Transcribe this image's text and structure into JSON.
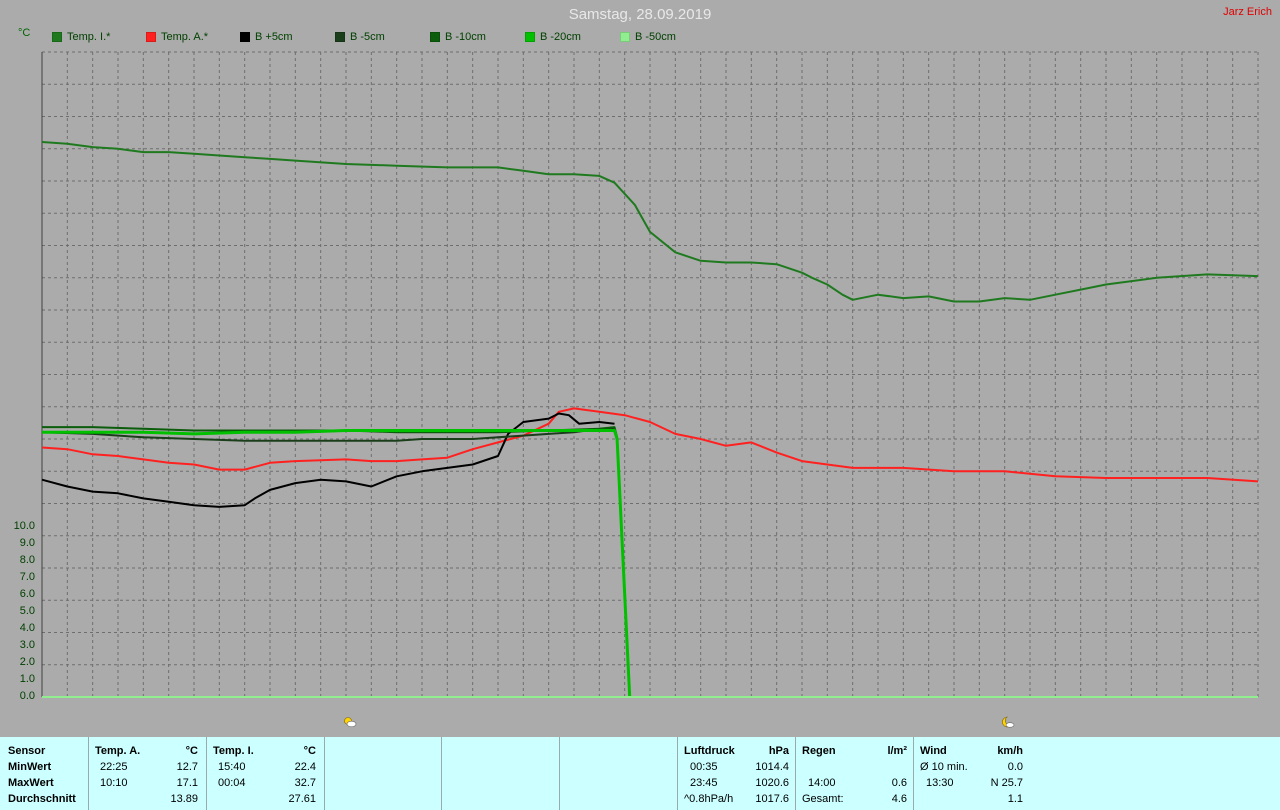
{
  "header": {
    "title": "Samstag, 28.09.2019",
    "author": "Jarz Erich",
    "unit": "°C"
  },
  "legend": [
    {
      "label": "Temp. I.*",
      "color": "#1f7a1f"
    },
    {
      "label": "Temp. A.*",
      "color": "#ff2020"
    },
    {
      "label": "B +5cm",
      "color": "#000000"
    },
    {
      "label": "B -5cm",
      "color": "#1a3d1a"
    },
    {
      "label": "B -10cm",
      "color": "#0b5c0b"
    },
    {
      "label": "B -20cm",
      "color": "#00c000"
    },
    {
      "label": "B -50cm",
      "color": "#90ee90"
    }
  ],
  "icons": {
    "left": "sun-cloud-icon",
    "right": "moon-icon"
  },
  "footer": {
    "sensor": {
      "h": "Sensor",
      "min": "MinWert",
      "max": "MaxWert",
      "avg": "Durchschnitt"
    },
    "temp_a": {
      "h": "Temp. A.",
      "u": "°C",
      "min_t": "22:25",
      "min_v": "12.7",
      "max_t": "10:10",
      "max_v": "17.1",
      "avg_v": "13.89"
    },
    "temp_i": {
      "h": "Temp. I.",
      "u": "°C",
      "min_t": "15:40",
      "min_v": "22.4",
      "max_t": "00:04",
      "max_v": "32.7",
      "avg_v": "27.61"
    },
    "luft": {
      "h": "Luftdruck",
      "u": "hPa",
      "min_t": "00:35",
      "min_v": "1014.4",
      "max_t": "23:45",
      "max_v": "1020.6",
      "avg_t": "^0.8hPa/h",
      "avg_v": "1017.6"
    },
    "regen": {
      "h": "Regen",
      "u": "l/m²",
      "max_t": "14:00",
      "max_v": "0.6",
      "avg_t": "Gesamt:",
      "avg_v": "4.6"
    },
    "wind": {
      "h": "Wind",
      "u": "km/h",
      "min_t": "Ø 10 min.",
      "min_v": "0.0",
      "max_t": "13:30",
      "max_v": "N 25.7",
      "avg_v": "1.1"
    }
  },
  "chart_data": {
    "type": "line",
    "title": "Samstag, 28.09.2019",
    "ylabel": "°C",
    "ylim": [
      0,
      38
    ],
    "xlim": [
      0,
      24
    ],
    "yticks": [
      "0.0",
      "1.0",
      "2.0",
      "3.0",
      "4.0",
      "5.0",
      "6.0",
      "7.0",
      "8.0",
      "9.0",
      "10.0"
    ],
    "grid": true,
    "series": [
      {
        "name": "Temp. I.*",
        "color": "#1f7a1f",
        "x": [
          0,
          0.5,
          1,
          1.5,
          2,
          2.5,
          3,
          3.5,
          4,
          4.5,
          5,
          6,
          7,
          8,
          8.5,
          9,
          9.5,
          10,
          10.5,
          11,
          11.3,
          11.7,
          12,
          12.5,
          13,
          13.5,
          14,
          14.5,
          15,
          15.2,
          15.5,
          15.8,
          16,
          16.5,
          17,
          17.5,
          18,
          18.5,
          19,
          19.5,
          20,
          20.5,
          21,
          22,
          23,
          24
        ],
        "y": [
          32.7,
          32.6,
          32.4,
          32.3,
          32.1,
          32.1,
          32.0,
          31.9,
          31.8,
          31.7,
          31.6,
          31.4,
          31.3,
          31.2,
          31.2,
          31.2,
          31.0,
          30.8,
          30.8,
          30.7,
          30.3,
          29.0,
          27.4,
          26.2,
          25.7,
          25.6,
          25.6,
          25.5,
          25.0,
          24.7,
          24.3,
          23.7,
          23.4,
          23.7,
          23.5,
          23.6,
          23.3,
          23.3,
          23.5,
          23.4,
          23.7,
          24.0,
          24.3,
          24.7,
          24.9,
          24.8
        ]
      },
      {
        "name": "Temp. A.*",
        "color": "#ff2020",
        "x": [
          0,
          0.5,
          1,
          1.5,
          2,
          2.5,
          3,
          3.5,
          4,
          4.5,
          5,
          6,
          6.5,
          7,
          7.5,
          8,
          8.5,
          9,
          9.5,
          10,
          10.2,
          10.5,
          11,
          11.5,
          12,
          12.5,
          13,
          13.5,
          14,
          14.5,
          15,
          16,
          17,
          18,
          18.5,
          19,
          20,
          21,
          22,
          23,
          24
        ],
        "y": [
          14.7,
          14.6,
          14.3,
          14.2,
          14.0,
          13.8,
          13.7,
          13.4,
          13.4,
          13.8,
          13.9,
          14.0,
          13.9,
          13.9,
          14.0,
          14.1,
          14.6,
          15.0,
          15.4,
          16.1,
          16.8,
          17.0,
          16.8,
          16.6,
          16.2,
          15.5,
          15.2,
          14.8,
          15.0,
          14.4,
          13.9,
          13.5,
          13.5,
          13.3,
          13.3,
          13.3,
          13.0,
          12.9,
          12.9,
          12.9,
          12.7
        ]
      },
      {
        "name": "B +5cm",
        "color": "#000000",
        "x": [
          0,
          0.5,
          1,
          1.5,
          2,
          2.5,
          3,
          3.5,
          4,
          4.2,
          4.5,
          5,
          5.5,
          6,
          6.5,
          7,
          7.5,
          8,
          8.5,
          9,
          9.2,
          9.5,
          10,
          10.2,
          10.4,
          10.6,
          11,
          11.3
        ],
        "y": [
          12.8,
          12.4,
          12.1,
          12.0,
          11.7,
          11.5,
          11.3,
          11.2,
          11.3,
          11.7,
          12.2,
          12.6,
          12.8,
          12.7,
          12.4,
          13.0,
          13.3,
          13.5,
          13.7,
          14.2,
          15.5,
          16.2,
          16.4,
          16.7,
          16.6,
          16.1,
          16.2,
          16.1
        ]
      },
      {
        "name": "B -5cm",
        "color": "#1a3d1a",
        "x": [
          0,
          1,
          2,
          3,
          4,
          5,
          6,
          7,
          7.5,
          8,
          8.5,
          9,
          9.5,
          10,
          10.5,
          11,
          11.3
        ],
        "y": [
          15.6,
          15.5,
          15.3,
          15.2,
          15.1,
          15.1,
          15.1,
          15.1,
          15.2,
          15.2,
          15.2,
          15.3,
          15.4,
          15.5,
          15.6,
          15.8,
          15.8
        ]
      },
      {
        "name": "B -10cm",
        "color": "#0b5c0b",
        "x": [
          0,
          1,
          2,
          3,
          4,
          5,
          6,
          7,
          8,
          9,
          10,
          11,
          11.3,
          11.35,
          11.6
        ],
        "y": [
          15.9,
          15.9,
          15.8,
          15.7,
          15.7,
          15.7,
          15.7,
          15.6,
          15.6,
          15.6,
          15.7,
          15.8,
          15.9,
          15.3,
          0.0
        ]
      },
      {
        "name": "B -20cm",
        "color": "#00c000",
        "x": [
          0,
          1,
          2,
          3,
          4,
          5,
          6,
          7,
          8,
          9,
          10,
          11,
          11.3,
          11.35,
          11.6
        ],
        "y": [
          15.6,
          15.6,
          15.6,
          15.5,
          15.6,
          15.6,
          15.7,
          15.7,
          15.7,
          15.7,
          15.7,
          15.7,
          15.7,
          15.2,
          0.0
        ]
      },
      {
        "name": "B -50cm",
        "color": "#90ee90",
        "x": [
          0,
          24
        ],
        "y": [
          0.0,
          0.0
        ]
      }
    ]
  }
}
